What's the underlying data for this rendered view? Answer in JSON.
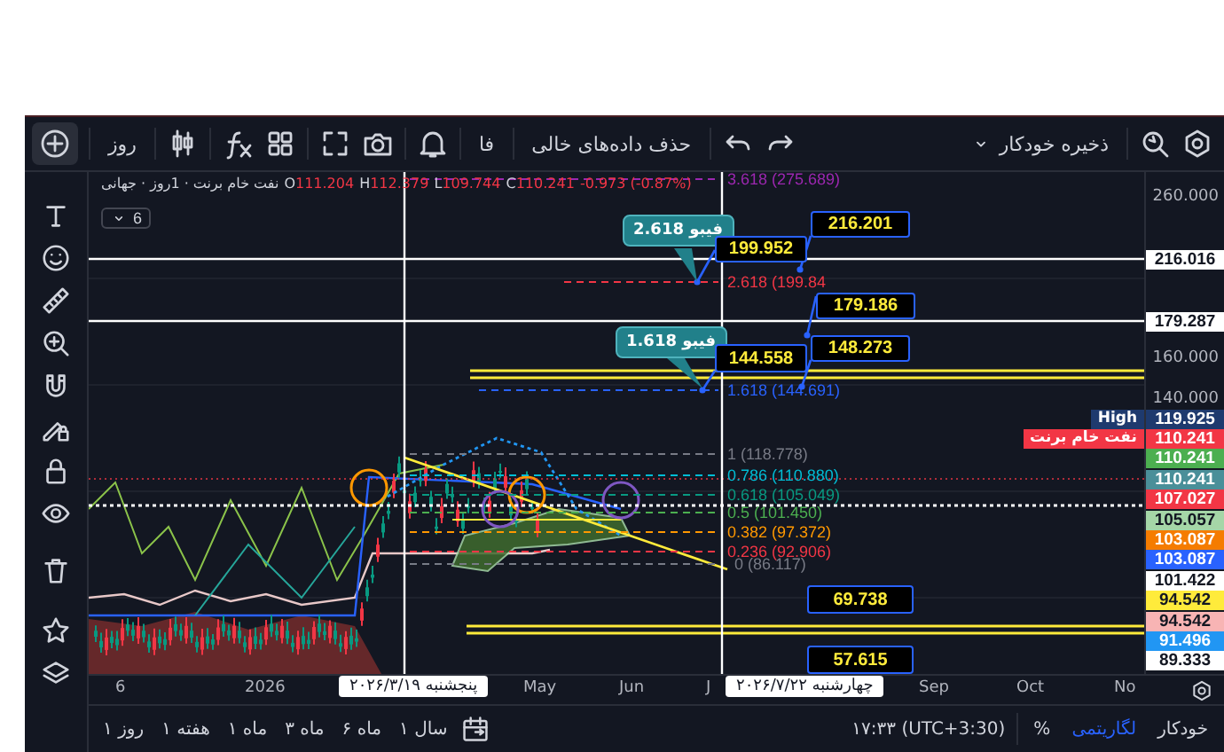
{
  "toolbar": {
    "interval": "روز",
    "language": "فا",
    "clear_gaps": "حذف داده‌های خالی",
    "autosave": "ذخیره خودکار"
  },
  "legend": {
    "symbol": "نفت خام برنت · 1روز · جهانی",
    "ohlc": [
      {
        "label": "O",
        "value": "111.204"
      },
      {
        "label": "H",
        "value": "112.379"
      },
      {
        "label": "L",
        "value": "109.744"
      },
      {
        "label": "C",
        "value": "110.241"
      }
    ],
    "change": "-0.973 (-0.87%)",
    "indicator_count": "6"
  },
  "fib_levels": [
    {
      "text": "3.618 (275.689)",
      "color": "#9c27b0"
    },
    {
      "text": "2.618 (199.84",
      "color": "#f23645"
    },
    {
      "text": "1.618 (144.691)",
      "color": "#2962ff"
    },
    {
      "text": "1 (118.778)",
      "color": "#787b86"
    },
    {
      "text": "0.786 (110.880)",
      "color": "#00bcd4"
    },
    {
      "text": "0.618 (105.049)",
      "color": "#089981"
    },
    {
      "text": "0.5 (101.450)",
      "color": "#4caf50"
    },
    {
      "text": "0.382 (97.372)",
      "color": "#ff9800"
    },
    {
      "text": "0.236 (92.906)",
      "color": "#f23645"
    },
    {
      "text": "0 (86.117)",
      "color": "#787b86"
    }
  ],
  "callouts": [
    {
      "text": "فیبو 2.618"
    },
    {
      "text": "فیبو 1.618"
    }
  ],
  "price_notes": [
    {
      "text": "216.201"
    },
    {
      "text": "199.952"
    },
    {
      "text": "179.186"
    },
    {
      "text": "144.558"
    },
    {
      "text": "148.273"
    },
    {
      "text": "69.738"
    },
    {
      "text": "57.615"
    }
  ],
  "price_axis": [
    {
      "kind": "tick",
      "text": "260.000"
    },
    {
      "kind": "tag",
      "text": "216.016",
      "color": "#ffffff"
    },
    {
      "kind": "tag",
      "text": "179.287",
      "color": "#ffffff"
    },
    {
      "kind": "tick",
      "text": "160.000"
    },
    {
      "kind": "tick",
      "text": "140.000"
    },
    {
      "kind": "tag",
      "text": "119.925",
      "title": "High",
      "color": "#1e3a6e"
    },
    {
      "kind": "tag",
      "text": "110.241",
      "title": "نفت خام برنت",
      "color": "#f23645"
    },
    {
      "kind": "tag",
      "text": "110.241",
      "color": "#4caf50"
    },
    {
      "kind": "tag",
      "text": "110.241",
      "color": "#4a8f99"
    },
    {
      "kind": "tag",
      "text": "107.027",
      "color": "#f23645"
    },
    {
      "kind": "tag",
      "text": "105.057",
      "color": "#a5d6a7"
    },
    {
      "kind": "tag",
      "text": "103.087",
      "color": "#f57c00"
    },
    {
      "kind": "tag",
      "text": "103.087",
      "color": "#2962ff"
    },
    {
      "kind": "tag",
      "text": "101.422",
      "color": "#ffffff"
    },
    {
      "kind": "tag",
      "text": "94.542",
      "color": "#ffeb3b"
    },
    {
      "kind": "tag",
      "text": "94.542",
      "color": "#f8b4b4"
    },
    {
      "kind": "tag",
      "text": "91.496",
      "color": "#2196f3"
    },
    {
      "kind": "tag",
      "text": "89.333",
      "color": "#ffffff"
    }
  ],
  "time_axis": {
    "labels": [
      "6",
      "2026",
      "May",
      "Jun",
      "J",
      "Sep",
      "Oct",
      "No"
    ],
    "cursor_dates": [
      "چهارشنبه ۲۰۲۶/۷/۲۲",
      "پنجشنبه ۲۰۲۶/۳/۱۹"
    ]
  },
  "bottom_bar": {
    "ranges": [
      "۱ سال",
      "۶ ماه",
      "۳ ماه",
      "۱ ماه",
      "۱ هفته",
      "۱ روز"
    ],
    "time": "۱۷:۳۳ (UTC+3:30)",
    "scale_modes": [
      {
        "label": "خودکار",
        "selected": false
      },
      {
        "label": "لگاریتمی",
        "selected": true
      },
      {
        "label": "%",
        "selected": false
      }
    ]
  }
}
